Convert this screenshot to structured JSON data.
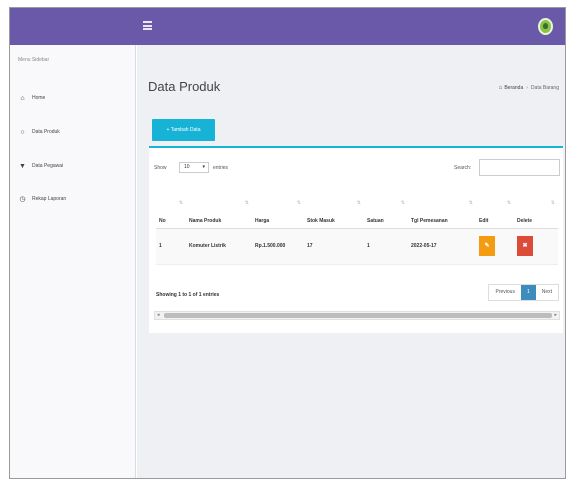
{
  "sidebar": {
    "header": "Menu Sidebar",
    "items": [
      {
        "label": "Home",
        "icon": "home-icon"
      },
      {
        "label": "Data Produk",
        "icon": "circle-icon"
      },
      {
        "label": "Data Pegawai",
        "icon": "bookmark-icon"
      },
      {
        "label": "Rekap Laporan",
        "icon": "clock-icon"
      }
    ]
  },
  "page": {
    "title": "Data Produk",
    "breadcrumb": {
      "home": "Beranda",
      "current": "Data Barang"
    }
  },
  "toolbar": {
    "add_label": "+ Tambah Data"
  },
  "table_controls": {
    "show_label": "Show",
    "entries_value": "10",
    "entries_label": "entries",
    "search_label": "Search:",
    "search_value": ""
  },
  "table": {
    "columns": [
      "No",
      "Nama Produk",
      "Harga",
      "Stok Masuk",
      "Satuan",
      "Tgl Pemesanan",
      "Edit",
      "Delete"
    ],
    "rows": [
      {
        "no": "1",
        "nama": "Komuter Listrik",
        "harga": "Rp.1.500.000",
        "stok": "17",
        "satuan": "1",
        "tgl": "2022-05-17"
      }
    ]
  },
  "footer": {
    "showing": "Showing 1 to 1 of 1 entries",
    "previous": "Previous",
    "page": "1",
    "next": "Next"
  },
  "colors": {
    "topbar": "#6a58a8",
    "accent": "#17b3d6",
    "edit": "#f39c12",
    "delete": "#dd4b39",
    "active_page": "#3c8dbc"
  }
}
